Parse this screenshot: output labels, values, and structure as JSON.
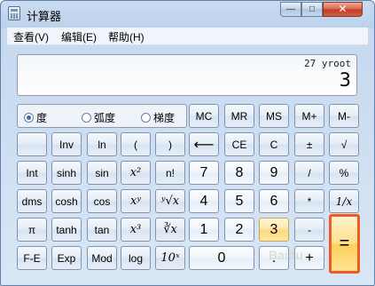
{
  "window": {
    "title": "计算器",
    "minimize": "—",
    "maximize": "□",
    "close": "✕"
  },
  "menu": [
    "查看(V)",
    "编辑(E)",
    "帮助(H)"
  ],
  "display": {
    "expression": "27 yroot",
    "value": "3"
  },
  "angle_mode": {
    "options": [
      "度",
      "弧度",
      "梯度"
    ],
    "selected": "度"
  },
  "buttons": {
    "mc": "MC",
    "mr": "MR",
    "ms": "MS",
    "mplus": "M+",
    "mminus": "M-",
    "inv": "Inv",
    "ln": "ln",
    "lparen": "(",
    "rparen": ")",
    "backspace": "⟵",
    "ce": "CE",
    "c": "C",
    "plusminus": "±",
    "sqrt": "√",
    "int": "Int",
    "sinh": "sinh",
    "sin": "sin",
    "square": "x²",
    "factorial": "n!",
    "n7": "7",
    "n8": "8",
    "n9": "9",
    "divide": "/",
    "percent": "%",
    "dms": "dms",
    "cosh": "cosh",
    "cos": "cos",
    "power": "xʸ",
    "yroot": "ʸ√x",
    "n4": "4",
    "n5": "5",
    "n6": "6",
    "multiply": "*",
    "reciprocal": "1/x",
    "pi": "π",
    "tanh": "tanh",
    "tan": "tan",
    "cube": "x³",
    "cuberoot": "∛x",
    "n1": "1",
    "n2": "2",
    "n3": "3",
    "minus": "-",
    "equals": "=",
    "fe": "F-E",
    "exp": "Exp",
    "mod": "Mod",
    "log": "log",
    "tenpow": "10ˣ",
    "n0": "0",
    "decimal": ".",
    "plus": "+"
  },
  "watermark": "Baidu"
}
